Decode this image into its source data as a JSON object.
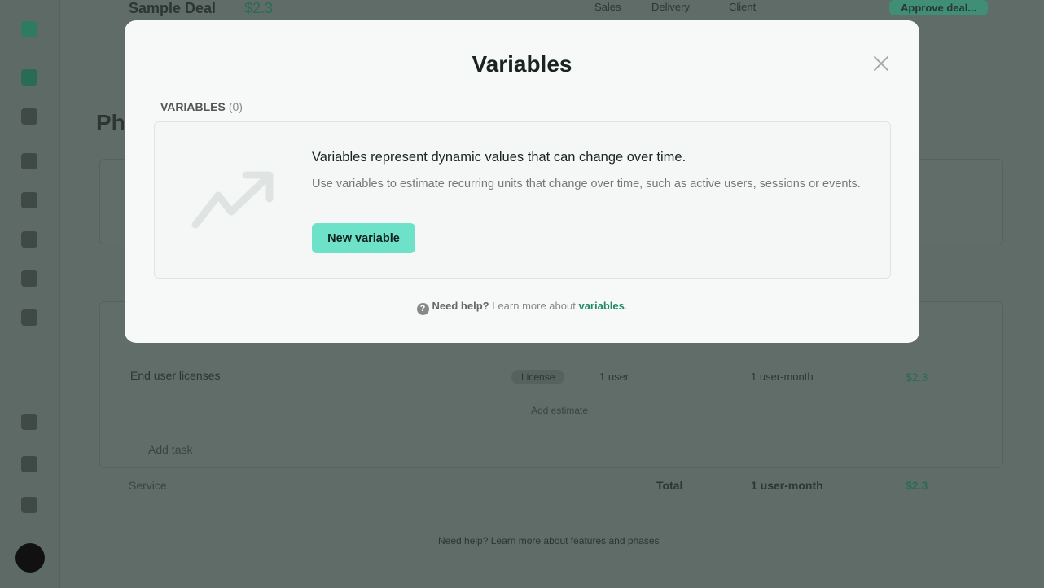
{
  "background": {
    "deal_title": "Sample Deal",
    "deal_price": "$2.3",
    "tabs": [
      "Sales",
      "Delivery",
      "Client"
    ],
    "approve_button": "Approve deal...",
    "phase_title": "Ph",
    "task_name": "End user licenses",
    "license_tag": "License",
    "quantity": "1 user",
    "unit": "1 user-month",
    "price": "$2.3",
    "add_estimate": "Add estimate",
    "add_task": "Add task",
    "service": "Service",
    "total_label": "Total",
    "total_unit": "1 user-month",
    "total_price": "$2.3",
    "help_text": "Need help? Learn more about features and phases"
  },
  "modal": {
    "title": "Variables",
    "section_label": "VARIABLES",
    "section_count": "(0)",
    "empty_heading": "Variables represent dynamic values that can change over time.",
    "empty_description": "Use variables to estimate recurring units that change over time, such as active users, sessions or events.",
    "new_button": "New variable",
    "help_bold": "Need help?",
    "help_text": "Learn more about",
    "help_link": "variables",
    "help_end": ".",
    "icon": "trending-up-icon",
    "accent_color": "#6ee2c9"
  }
}
